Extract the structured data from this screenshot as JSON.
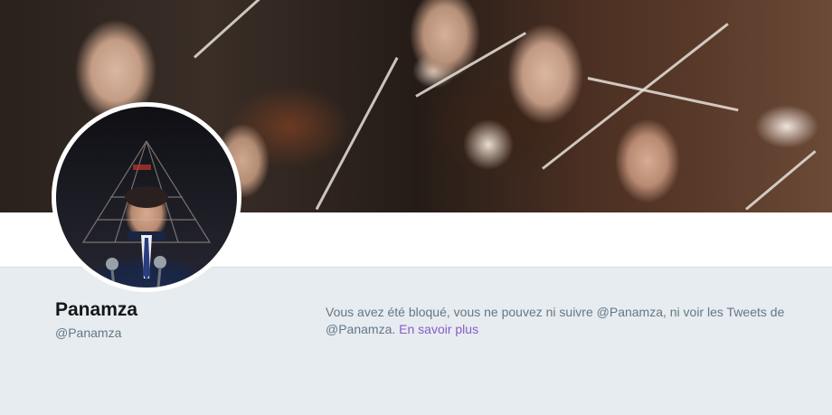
{
  "profile": {
    "display_name": "Panamza",
    "handle": "@Panamza"
  },
  "blocked_notice": {
    "message_part1": "Vous avez été bloqué, vous ne pouvez ni suivre @Panamza, ni voir les Tweets de @Panamza.",
    "learn_more_link": "En savoir plus"
  },
  "colors": {
    "page_background": "#e6ecf0",
    "name_text": "#14171a",
    "secondary_text": "#657786",
    "link": "#8a5cc4"
  }
}
